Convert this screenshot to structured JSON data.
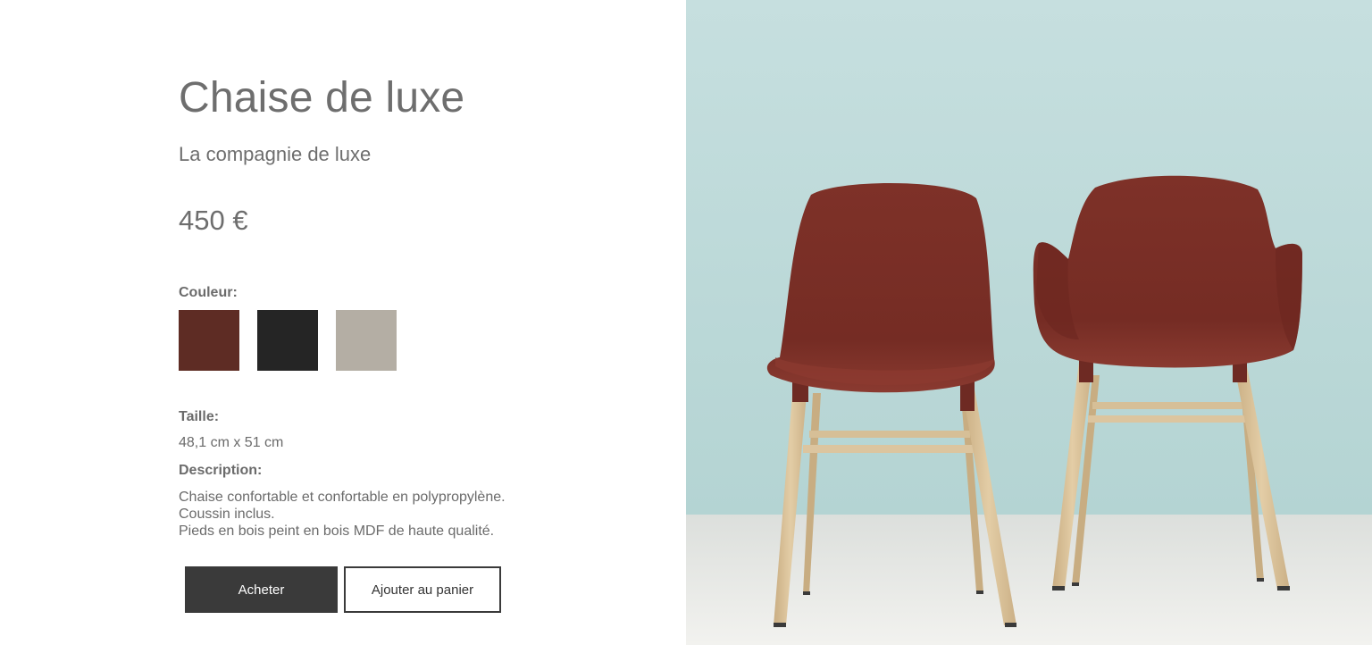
{
  "product": {
    "title": "Chaise de luxe",
    "brand": "La compagnie de luxe",
    "price": "450 €"
  },
  "color": {
    "label": "Couleur:",
    "swatches": [
      {
        "name": "brun-rouge",
        "hex": "#5e2c24"
      },
      {
        "name": "noir",
        "hex": "#252525"
      },
      {
        "name": "gris",
        "hex": "#b4aea4"
      }
    ]
  },
  "size": {
    "label": "Taille:",
    "value": "48,1 cm x 51 cm"
  },
  "description": {
    "label": "Description:",
    "lines": [
      "Chaise confortable et confortable en polypropylène.",
      "Coussin inclus.",
      "Pieds en bois peint en bois MDF de haute qualité."
    ]
  },
  "actions": {
    "buy_label": "Acheter",
    "cart_label": "Ajouter au panier"
  },
  "colors": {
    "wall": "#c2dcdc",
    "floor": "#ededea",
    "seat": "#7b2e26",
    "wood": "#dcc59c",
    "button_dark": "#3a3a3a"
  }
}
